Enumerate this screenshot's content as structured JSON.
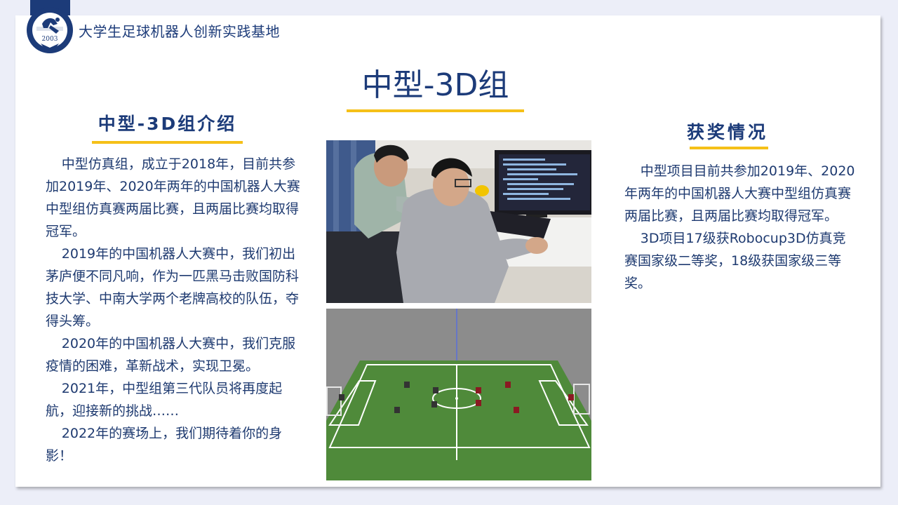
{
  "header": {
    "org_name": "大学生足球机器人创新实践基地",
    "logo_year": "2003"
  },
  "title": "中型-3D组",
  "intro": {
    "heading": "中型-3D组介绍",
    "paragraphs": [
      "中型仿真组，成立于2018年，目前共参加2019年、2020年两年的中国机器人大赛中型组仿真赛两届比赛，且两届比赛均取得冠军。",
      "2019年的中国机器人大赛中，我们初出茅庐便不同凡响，作为一匹黑马击败国防科技大学、中南大学两个老牌高校的队伍，夺得头筹。",
      "2020年的中国机器人大赛中，我们克服疫情的困难，革新战术，实现卫冕。",
      "2021年，中型组第三代队员将再度起航，迎接新的挑战……",
      "2022年的赛场上，我们期待着你的身影！"
    ]
  },
  "awards": {
    "heading": "获奖情况",
    "paragraphs": [
      "中型项目目前共参加2019年、2020年两年的中国机器人大赛中型组仿真赛两届比赛，且两届比赛均取得冠军。",
      "3D项目17级获Robocup3D仿真竞赛国家级二等奖，18级获国家级三等奖。"
    ]
  },
  "colors": {
    "navy": "#1c3b79",
    "accent": "#f5c018",
    "background": "#eceef8"
  }
}
